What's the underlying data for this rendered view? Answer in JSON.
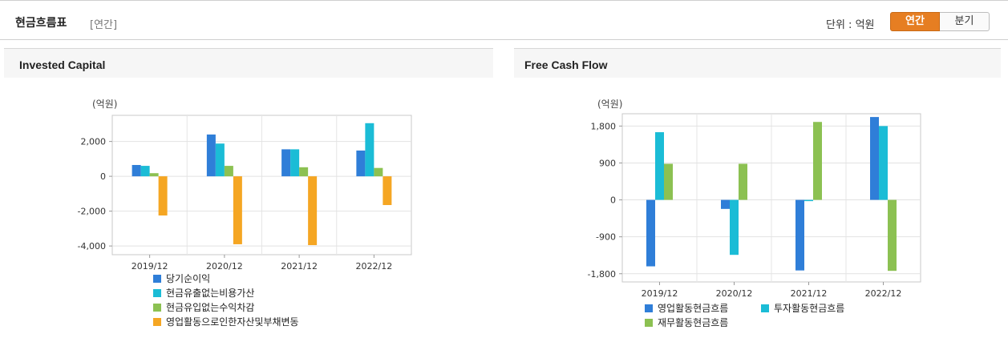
{
  "header": {
    "title": "현금흐름표",
    "period": "[연간]",
    "unit_label": "단위 : 억원",
    "annual_btn": "연간",
    "quarter_btn": "분기"
  },
  "colors": {
    "accent": "#e67e22",
    "blue": "#2f7ed8",
    "cyan": "#1bbcd6",
    "green": "#8cc152",
    "orange": "#f5a623"
  },
  "chart_data": [
    {
      "type": "bar",
      "title": "Invested Capital",
      "unit": "(억원)",
      "categories": [
        "2019/12",
        "2020/12",
        "2021/12",
        "2022/12"
      ],
      "ylim": [
        -4500,
        3500
      ],
      "yticks": [
        2000,
        0,
        -2000,
        -4000
      ],
      "ytick_labels": [
        "2,000",
        "0",
        "-2,000",
        "-4,000"
      ],
      "grid": true,
      "legend": "bottom",
      "series": [
        {
          "name": "당기순이익",
          "color": "#2f7ed8",
          "values": [
            650,
            2400,
            1550,
            1480
          ]
        },
        {
          "name": "현금유출없는비용가산",
          "color": "#1bbcd6",
          "values": [
            600,
            1880,
            1550,
            3050
          ]
        },
        {
          "name": "현금유입없는수익차감",
          "color": "#8cc152",
          "values": [
            180,
            600,
            520,
            480
          ]
        },
        {
          "name": "영업활동으로인한자산및부채변동",
          "color": "#f5a623",
          "values": [
            -2250,
            -3900,
            -3950,
            -1650
          ]
        }
      ]
    },
    {
      "type": "bar",
      "title": "Free Cash Flow",
      "unit": "(억원)",
      "categories": [
        "2019/12",
        "2020/12",
        "2021/12",
        "2022/12"
      ],
      "ylim": [
        -2000,
        2100
      ],
      "yticks": [
        1800,
        900,
        0,
        -900,
        -1800
      ],
      "ytick_labels": [
        "1,800",
        "900",
        "0",
        "-900",
        "-1,800"
      ],
      "grid": true,
      "legend": "bottom",
      "series": [
        {
          "name": "영업활동현금흐름",
          "color": "#2f7ed8",
          "values": [
            -1620,
            -220,
            -1720,
            2020
          ]
        },
        {
          "name": "투자활동현금흐름",
          "color": "#1bbcd6",
          "values": [
            1650,
            -1340,
            -30,
            1800
          ]
        },
        {
          "name": "재무활동현금흐름",
          "color": "#8cc152",
          "values": [
            880,
            880,
            1900,
            -1730
          ]
        }
      ]
    }
  ]
}
